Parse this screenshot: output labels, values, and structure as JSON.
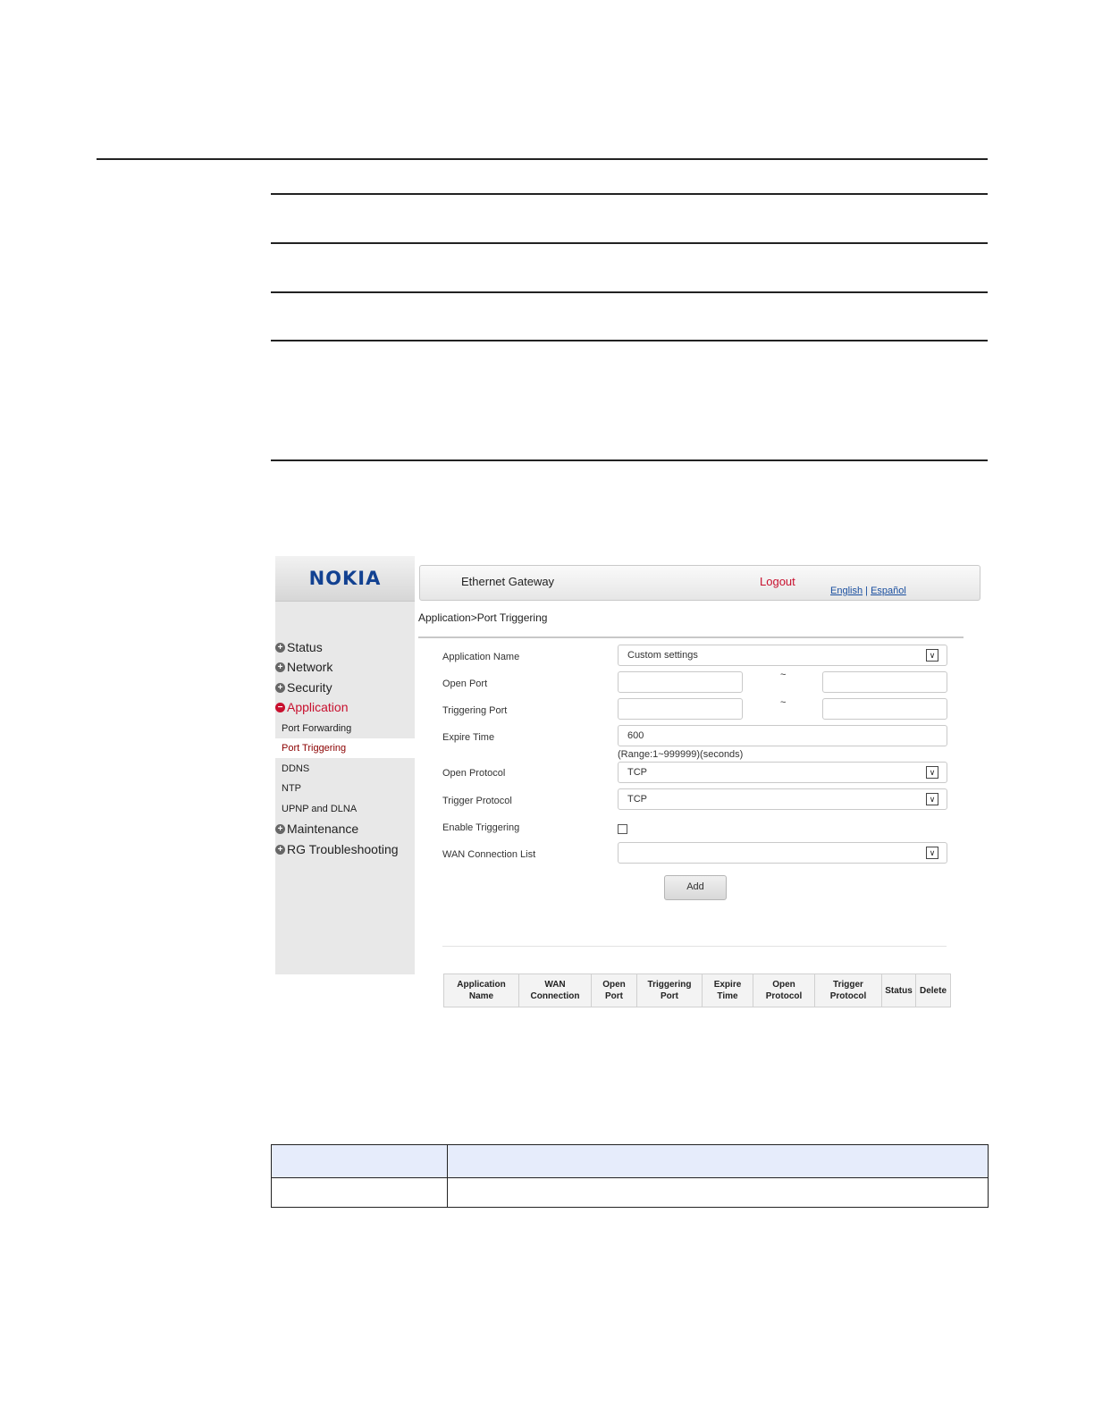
{
  "app": {
    "logo": "NOKIA",
    "header_title": "Ethernet Gateway",
    "logout": "Logout",
    "lang_english": "English",
    "lang_separator": "|",
    "lang_spanish": "Español",
    "breadcrumb": "Application>Port Triggering"
  },
  "sidebar": {
    "items": [
      {
        "label": "Status"
      },
      {
        "label": "Network"
      },
      {
        "label": "Security"
      },
      {
        "label": "Application"
      },
      {
        "label": "Maintenance"
      },
      {
        "label": "RG Troubleshooting"
      }
    ],
    "sub_items": [
      {
        "label": "Port Forwarding"
      },
      {
        "label": "Port Triggering"
      },
      {
        "label": "DDNS"
      },
      {
        "label": "NTP"
      },
      {
        "label": "UPNP and DLNA"
      }
    ]
  },
  "form": {
    "application_name_label": "Application Name",
    "application_name_value": "Custom settings",
    "open_port_label": "Open Port",
    "open_port_start": "",
    "open_port_end": "",
    "triggering_port_label": "Triggering Port",
    "triggering_port_start": "",
    "triggering_port_end": "",
    "range_separator": "~",
    "expire_time_label": "Expire Time",
    "expire_time_value": "600",
    "expire_time_hint": "(Range:1~999999)(seconds)",
    "open_protocol_label": "Open Protocol",
    "open_protocol_value": "TCP",
    "trigger_protocol_label": "Trigger Protocol",
    "trigger_protocol_value": "TCP",
    "enable_triggering_label": "Enable Triggering",
    "enable_triggering_checked": false,
    "wan_connection_label": "WAN Connection List",
    "wan_connection_value": "",
    "add_button": "Add"
  },
  "table": {
    "columns": [
      [
        "Application",
        "Name"
      ],
      [
        "WAN",
        "Connection"
      ],
      [
        "Open",
        "Port"
      ],
      [
        "Triggering",
        "Port"
      ],
      [
        "Expire",
        "Time"
      ],
      [
        "Open",
        "Protocol"
      ],
      [
        "Trigger",
        "Protocol"
      ],
      [
        "Status",
        ""
      ],
      [
        "Delete",
        ""
      ]
    ]
  }
}
